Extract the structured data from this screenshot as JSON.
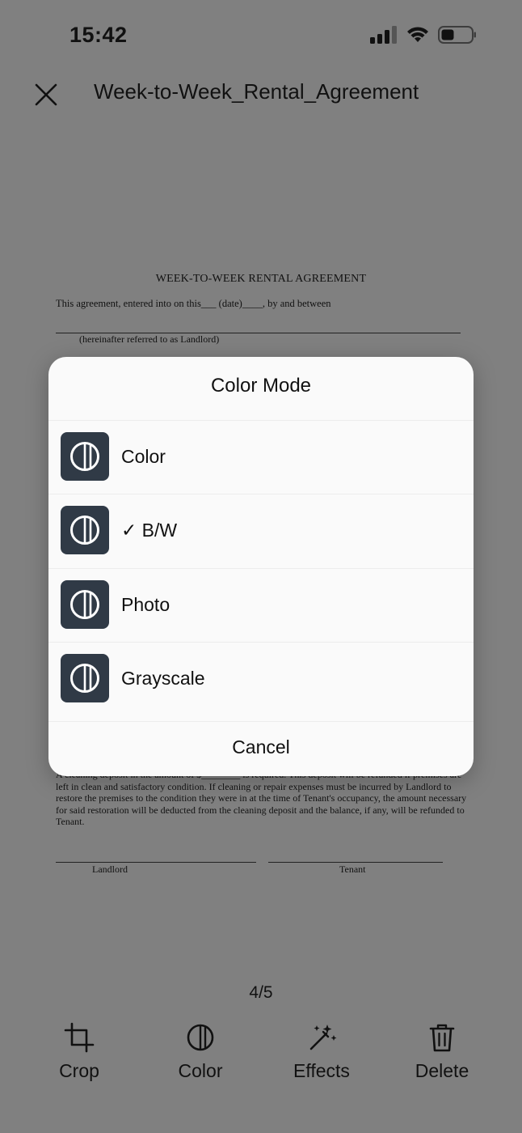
{
  "status": {
    "time": "15:42"
  },
  "header": {
    "title": "Week-to-Week_Rental_Agreement"
  },
  "document": {
    "heading": "WEEK-TO-WEEK RENTAL AGREEMENT",
    "line1": "This agreement, entered into on this___ (date)____, by and between",
    "line2": "(hereinafter referred to as Landlord)",
    "paragraph": "A cleaning deposit in the amount of $________ is required. This deposit will be refunded if premises are left in clean and satisfactory condition. If cleaning or repair expenses must be incurred by Landlord to restore the premises to the condition they were in at the time of Tenant's occupancy, the amount necessary for said restoration will be deducted from the cleaning deposit and the balance, if any, will be refunded to Tenant.",
    "sig_landlord": "Landlord",
    "sig_tenant": "Tenant"
  },
  "sheet": {
    "title": "Color Mode",
    "options": [
      {
        "label": "Color",
        "icon": "contrast-icon"
      },
      {
        "label": "✓ B/W",
        "icon": "contrast-icon"
      },
      {
        "label": "Photo",
        "icon": "contrast-icon"
      },
      {
        "label": "Grayscale",
        "icon": "contrast-icon"
      }
    ],
    "cancel": "Cancel"
  },
  "pager": "4/5",
  "toolbar": {
    "crop": "Crop",
    "color": "Color",
    "effects": "Effects",
    "delete": "Delete"
  },
  "colors": {
    "overlay": "#808080",
    "sheet_bg": "#fafafa",
    "icon_bg": "#303a46"
  }
}
